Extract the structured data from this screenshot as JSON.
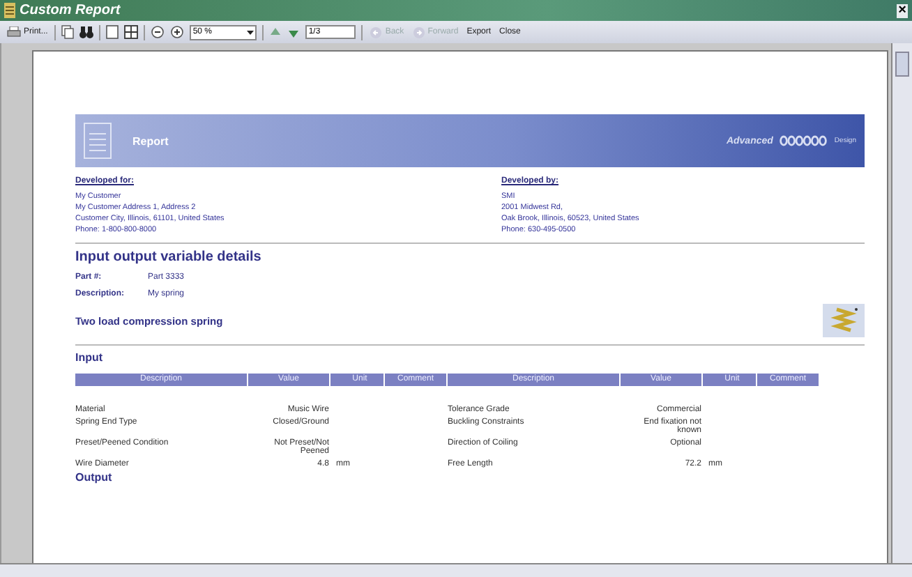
{
  "window": {
    "title": "Custom Report",
    "close": "×"
  },
  "toolbar": {
    "print": "Print...",
    "zoom": "50 %",
    "page": "1/3",
    "back": {
      "label": "Back",
      "disabled": true
    },
    "forward": {
      "label": "Forward",
      "disabled": true
    },
    "export": "Export",
    "close": "Close"
  },
  "banner": {
    "title": "Report",
    "brand": "Advanced",
    "brand_suffix": "Design"
  },
  "developed_for": {
    "heading": "Developed for:",
    "lines": [
      "My Customer",
      "My Customer Address 1, Address 2",
      "Customer City, Illinois, 61101, United States",
      "Phone: 1-800-800-8000"
    ]
  },
  "developed_by": {
    "heading": "Developed by:",
    "lines": [
      "SMI",
      "2001 Midwest Rd,",
      "Oak Brook, Illinois, 60523, United States",
      "Phone: 630-495-0500"
    ]
  },
  "details": {
    "heading": "Input output variable details",
    "fields": [
      {
        "label": "Part #:",
        "value": "Part 3333"
      },
      {
        "label": "Description:",
        "value": "My spring"
      }
    ],
    "spring_type": "Two load compression spring"
  },
  "input": {
    "heading": "Input",
    "columns": [
      "Description",
      "Value",
      "Unit",
      "Comment",
      "Description",
      "Value",
      "Unit",
      "Comment"
    ],
    "rows": [
      {
        "left": {
          "description": "Material",
          "value": "Music Wire"
        },
        "right": {
          "description": "Tolerance Grade",
          "value": "Commercial"
        }
      },
      {
        "left": {
          "description": "Spring End Type",
          "value": "Closed/Ground"
        },
        "right": {
          "description": "Buckling Constraints",
          "value": "End fixation not known"
        }
      },
      {
        "left": {
          "description": "Preset/Peened Condition",
          "value": "Not Preset/Not Peened"
        },
        "right": {
          "description": "Direction of Coiling",
          "value": "Optional"
        }
      },
      {
        "left": {
          "description": "Wire Diameter",
          "value": "4.8",
          "unit": "mm"
        },
        "right": {
          "description": "Free Length",
          "value": "72.2",
          "unit": "mm"
        }
      }
    ]
  },
  "output": {
    "heading": "Output"
  }
}
